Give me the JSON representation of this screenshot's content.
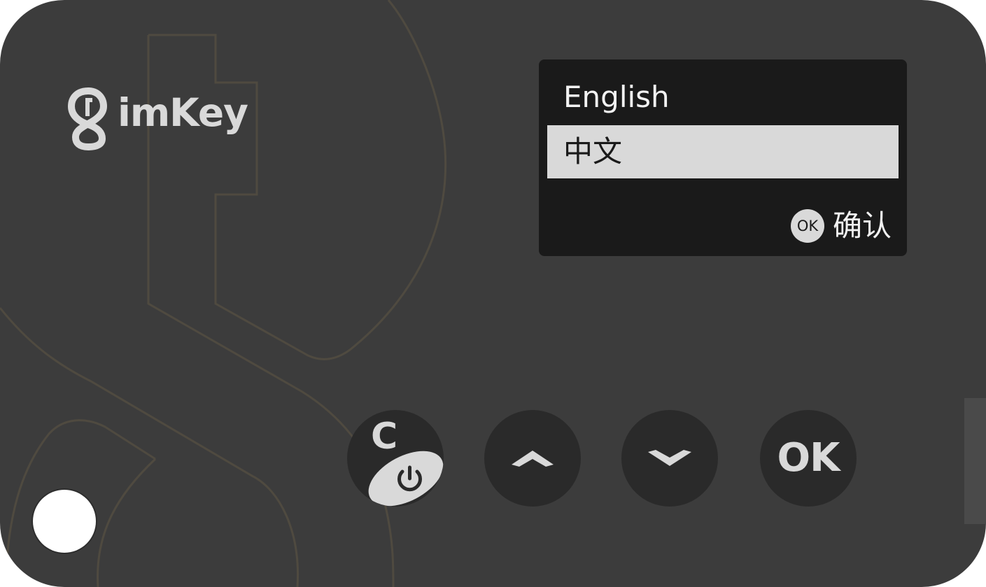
{
  "device": {
    "brand": "imKey",
    "body_color": "#3c3c3c",
    "accent_color": "#d9d9d9",
    "pattern_line_color": "#4f4a40"
  },
  "screen": {
    "background": "#1a1a1a",
    "languages": [
      {
        "label": "English",
        "selected": false
      },
      {
        "label": "中文",
        "selected": true
      }
    ],
    "confirm": {
      "badge": "OK",
      "label": "确认"
    }
  },
  "buttons": {
    "clear_power": {
      "label": "C",
      "icon": "power-icon"
    },
    "up": {
      "icon": "chevron-up-icon"
    },
    "down": {
      "icon": "chevron-down-icon"
    },
    "ok": {
      "label": "OK"
    }
  }
}
